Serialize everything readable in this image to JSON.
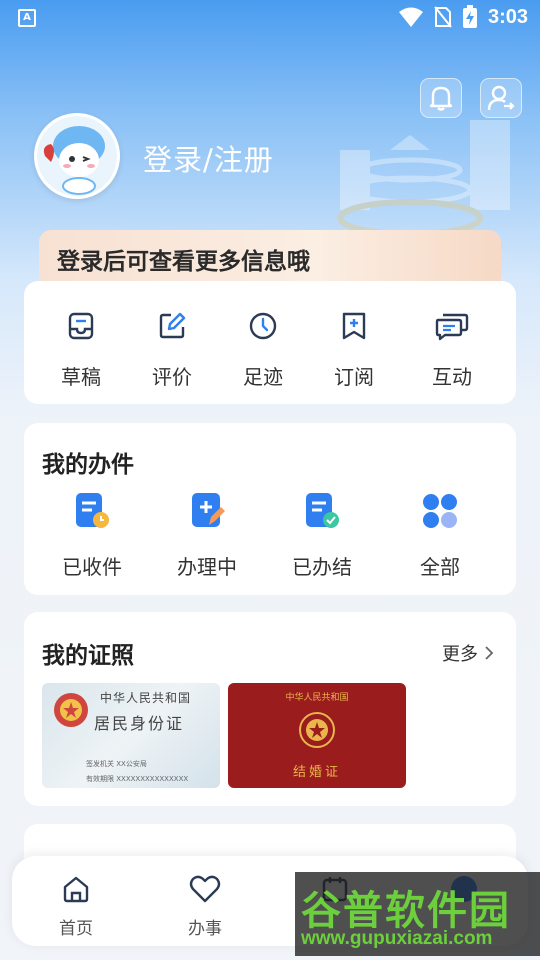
{
  "status_bar": {
    "time": "3:03",
    "app_badge": "A"
  },
  "header": {
    "login_label": "登录/注册"
  },
  "banner": {
    "text": "登录后可查看更多信息哦"
  },
  "quick_actions": [
    {
      "label": "草稿",
      "icon": "inbox-icon"
    },
    {
      "label": "评价",
      "icon": "edit-icon"
    },
    {
      "label": "足迹",
      "icon": "clock-icon"
    },
    {
      "label": "订阅",
      "icon": "bookmark-icon"
    },
    {
      "label": "互动",
      "icon": "chat-icon"
    }
  ],
  "my_tasks": {
    "title": "我的办件",
    "items": [
      {
        "label": "已收件",
        "icon": "doc-clock-icon"
      },
      {
        "label": "办理中",
        "icon": "doc-edit-icon"
      },
      {
        "label": "已办结",
        "icon": "doc-check-icon"
      },
      {
        "label": "全部",
        "icon": "grid-icon"
      }
    ]
  },
  "my_certificates": {
    "title": "我的证照",
    "more_label": "更多",
    "id_card": {
      "line1": "中华人民共和国",
      "line2": "居民身份证",
      "line3": "签发机关 XX公安局",
      "line4": "有效期限 XXXXXXXXXXXXXXX"
    },
    "marriage_card": {
      "line1": "中华人民共和国",
      "line2": "结婚证"
    }
  },
  "bottom_nav": [
    {
      "label": "首页",
      "icon": "home-icon"
    },
    {
      "label": "办事",
      "icon": "heart-icon"
    },
    {
      "label": "",
      "icon": "calendar-icon"
    },
    {
      "label": "",
      "icon": "user-icon"
    }
  ],
  "watermark": {
    "title": "谷普软件园",
    "url": "www.gupuxiazai.com"
  },
  "colors": {
    "accent": "#2f7ff0",
    "primary_blue": "#4a9cf0",
    "cert_red": "#9b1c1c"
  }
}
